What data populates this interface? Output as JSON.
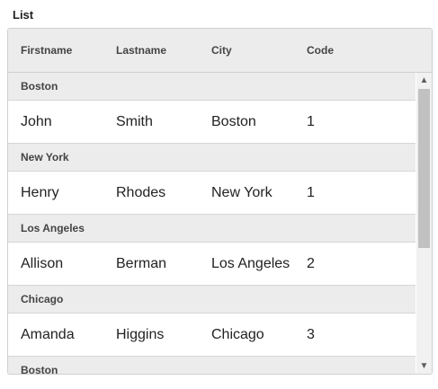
{
  "title": "List",
  "columns": [
    "Firstname",
    "Lastname",
    "City",
    "Code"
  ],
  "groups": [
    {
      "label": "Boston",
      "row": [
        "John",
        "Smith",
        "Boston",
        "1"
      ]
    },
    {
      "label": "New York",
      "row": [
        "Henry",
        "Rhodes",
        "New York",
        "1"
      ]
    },
    {
      "label": "Los Angeles",
      "row": [
        "Allison",
        "Berman",
        "Los Angeles",
        "2"
      ]
    },
    {
      "label": "Chicago",
      "row": [
        "Amanda",
        "Higgins",
        "Chicago",
        "3"
      ]
    },
    {
      "label": "Boston"
    }
  ],
  "scrollbar": {
    "up_icon": "chevron-up-icon",
    "down_icon": "chevron-down-icon"
  }
}
